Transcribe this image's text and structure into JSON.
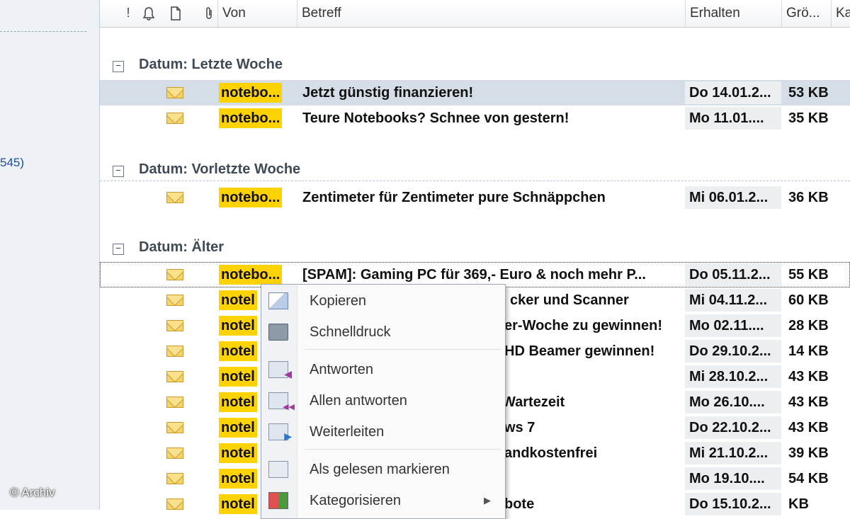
{
  "nav": {
    "folder_count": "545)"
  },
  "watermark": "© Archiv",
  "columns": {
    "importance": "!",
    "reminder_icon": "bell-icon",
    "icon_col": "document-icon",
    "attachment_icon": "paperclip-icon",
    "from": "Von",
    "subject": "Betreff",
    "received": "Erhalten",
    "size": "Grö...",
    "category": "Ka"
  },
  "groups": [
    {
      "label": "Datum: Letzte Woche"
    },
    {
      "label": "Datum: Vorletzte Woche"
    },
    {
      "label": "Datum: Älter"
    }
  ],
  "messages": [
    {
      "from": "notebo...",
      "subject": "Jetzt günstig finanzieren!",
      "received": "Do 14.01.2...",
      "size": "53 KB"
    },
    {
      "from": "notebo...",
      "subject": "Teure Notebooks? Schnee von gestern!",
      "received": "Mo 11.01....",
      "size": "35 KB"
    },
    {
      "from": "notebo...",
      "subject": "Zentimeter für Zentimeter pure Schnäppchen",
      "received": "Mi 06.01.2...",
      "size": "36 KB"
    },
    {
      "from": "notebo...",
      "subject": "[SPAM]: Gaming PC für 369,- Euro & noch mehr P...",
      "received": "Do 05.11.2...",
      "size": "55 KB"
    },
    {
      "from": "notel",
      "subject": "cker und Scanner",
      "received": "Mi 04.11.2...",
      "size": "60 KB"
    },
    {
      "from": "notel",
      "subject": "er-Woche zu gewinnen!",
      "received": "Mo 02.11....",
      "size": "28 KB"
    },
    {
      "from": "notel",
      "subject": "HD Beamer gewinnen!",
      "received": "Do 29.10.2...",
      "size": "14 KB"
    },
    {
      "from": "notel",
      "subject": "",
      "received": "Mi 28.10.2...",
      "size": "43 KB"
    },
    {
      "from": "notel",
      "subject": "Wartezeit",
      "received": "Mo 26.10....",
      "size": "43 KB"
    },
    {
      "from": "notel",
      "subject": "ws 7",
      "received": "Do 22.10.2...",
      "size": "43 KB"
    },
    {
      "from": "notel",
      "subject": "andkostenfrei",
      "received": "Mi 21.10.2...",
      "size": "39 KB"
    },
    {
      "from": "notel",
      "subject": "",
      "received": "Mo 19.10....",
      "size": "54 KB"
    },
    {
      "from": "notel",
      "subject": "bote",
      "received": "Do 15.10.2...",
      "size": "KB"
    }
  ],
  "context_menu": {
    "items": [
      {
        "label": "Kopieren",
        "icon": "copy-icon"
      },
      {
        "label": "Schnelldruck",
        "icon": "printer-icon"
      },
      {
        "label": "Antworten",
        "icon": "reply-icon"
      },
      {
        "label": "Allen antworten",
        "icon": "reply-all-icon"
      },
      {
        "label": "Weiterleiten",
        "icon": "forward-icon"
      },
      {
        "label": "Als gelesen markieren",
        "icon": "mark-read-icon"
      },
      {
        "label": "Kategorisieren",
        "icon": "categorize-icon"
      }
    ]
  },
  "colors": {
    "sender_highlight": "#ffd200",
    "selected_row": "#d5dde6"
  }
}
